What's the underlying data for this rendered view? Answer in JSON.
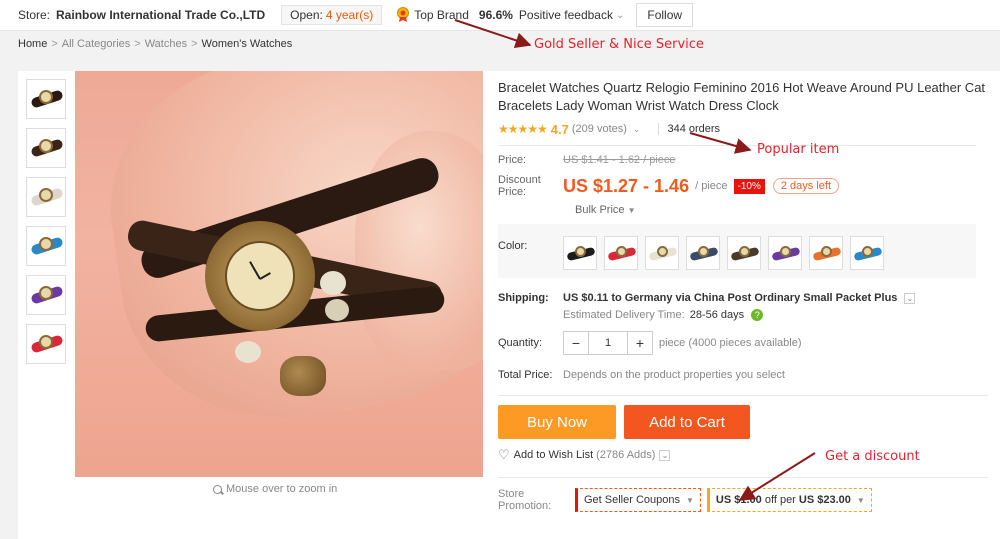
{
  "store": {
    "label": "Store:",
    "name": "Rainbow International Trade Co.,LTD",
    "open_label": "Open:",
    "open_years": "4 year(s)",
    "top_brand": "Top Brand",
    "feedback_pct": "96.6%",
    "feedback_label": "Positive feedback",
    "follow_label": "Follow"
  },
  "breadcrumb": [
    "Home",
    "All Categories",
    "Watches",
    "Women's Watches"
  ],
  "product": {
    "title": "Bracelet Watches Quartz Relogio Feminino 2016 Hot Weave Around PU Leather Cat Bracelets Lady Woman Wrist Watch Dress Clock",
    "rating_stars": "★★★★★",
    "rating": "4.7",
    "votes": "(209 votes)",
    "orders": "344 orders",
    "price_label": "Price:",
    "price_old": "US $1.41 - 1.62 / piece",
    "discount_label_1": "Discount",
    "discount_label_2": "Price:",
    "price_new": "US $1.27 - 1.46",
    "per_piece": "/ piece",
    "off_badge": "-10%",
    "days_left": "2 days left",
    "bulk_price": "Bulk Price",
    "color_label": "Color:",
    "colors": [
      {
        "band": "#1c1c1c"
      },
      {
        "band": "#d8283a"
      },
      {
        "band": "#e8e2d6"
      },
      {
        "band": "#3a4a6a"
      },
      {
        "band": "#4a3a2a"
      },
      {
        "band": "#6a3aa0"
      },
      {
        "band": "#e8722a"
      },
      {
        "band": "#2a88c8"
      }
    ],
    "shipping_label": "Shipping:",
    "shipping_text": "US $0.11 to Germany via China Post Ordinary Small Packet Plus",
    "delivery_label": "Estimated Delivery Time:",
    "delivery_days": "28-56 days",
    "quantity_label": "Quantity:",
    "quantity_value": "1",
    "quantity_minus": "−",
    "quantity_plus": "+",
    "quantity_info": "piece (4000 pieces available)",
    "total_label": "Total Price:",
    "total_text": "Depends on the product properties you select",
    "buy_now": "Buy Now",
    "add_to_cart": "Add to Cart",
    "wishlist": "Add to Wish List",
    "wishlist_count": "(2786 Adds)",
    "promo_label_1": "Store",
    "promo_label_2": "Promotion:",
    "coupons": "Get Seller Coupons",
    "offer_a": "US $1.00",
    "offer_b": "off per",
    "offer_c": "US $23.00",
    "zoom_hint": "Mouse over to zoom in"
  },
  "thumbnails": [
    {
      "band": "#2a1a12"
    },
    {
      "band": "#3a2418"
    },
    {
      "band": "#dcd6cc"
    },
    {
      "band": "#2a88c8"
    },
    {
      "band": "#6a3aa0"
    },
    {
      "band": "#d8283a"
    }
  ],
  "annotations": {
    "gold_seller": "Gold Seller & Nice Service",
    "popular": "Popular item",
    "discount": "Get a discount",
    "color": "#e0242e"
  }
}
